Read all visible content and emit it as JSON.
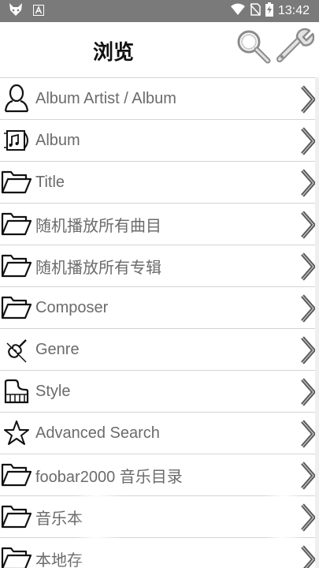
{
  "status_bar": {
    "time": "13:42",
    "left_icons": [
      "fox-icon",
      "notification-a-icon"
    ],
    "right_icons": [
      "wifi-icon",
      "no-sim-icon",
      "battery-charging-icon"
    ]
  },
  "header": {
    "title": "浏览",
    "search_icon": "search-icon",
    "settings_icon": "wrench-icon"
  },
  "list": {
    "items": [
      {
        "label": "Album Artist / Album",
        "icon": "person-icon"
      },
      {
        "label": "Album",
        "icon": "album-icon"
      },
      {
        "label": "Title",
        "icon": "folder-icon"
      },
      {
        "label": "随机播放所有曲目",
        "icon": "folder-icon"
      },
      {
        "label": "随机播放所有专辑",
        "icon": "folder-icon"
      },
      {
        "label": "Composer",
        "icon": "folder-icon"
      },
      {
        "label": "Genre",
        "icon": "violin-icon"
      },
      {
        "label": "Style",
        "icon": "piano-icon"
      },
      {
        "label": "Advanced Search",
        "icon": "star-icon"
      },
      {
        "label": "foobar2000 音乐目录",
        "icon": "folder-icon"
      },
      {
        "label": "音乐本",
        "icon": "folder-icon"
      },
      {
        "label": "本地存",
        "icon": "folder-icon"
      }
    ]
  },
  "colors": {
    "status_bar": "#7a7a7a",
    "label_text": "#6b6b6b",
    "divider": "#d4d4d4",
    "chevron": "#555555"
  }
}
